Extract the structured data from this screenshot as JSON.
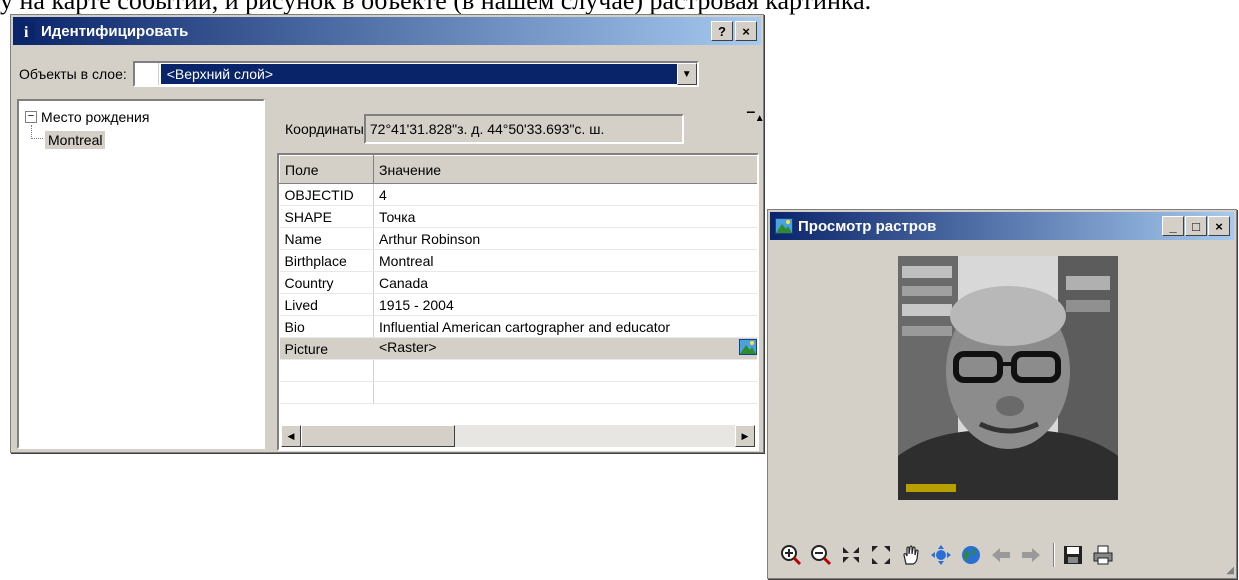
{
  "identify": {
    "title": "Идентифицировать",
    "help_btn": "?",
    "close_btn": "×",
    "layer_label": "Объекты в слое:",
    "layer_value": "<Верхний слой>",
    "tree": {
      "root": "Место рождения",
      "child": "Montreal"
    },
    "coords_label": "Координаты",
    "coords_value": "72°41'31.828\"з. д.  44°50'33.693\"с. ш.",
    "columns": [
      "Поле",
      "Значение"
    ],
    "rows": [
      {
        "field": "OBJECTID",
        "value": "4"
      },
      {
        "field": "SHAPE",
        "value": "Точка"
      },
      {
        "field": "Name",
        "value": "Arthur Robinson"
      },
      {
        "field": "Birthplace",
        "value": "Montreal"
      },
      {
        "field": "Country",
        "value": "Canada"
      },
      {
        "field": "Lived",
        "value": "1915 - 2004"
      },
      {
        "field": "Bio",
        "value": "Influential American cartographer and educator"
      },
      {
        "field": "Picture",
        "value": "<Raster>"
      }
    ]
  },
  "viewer": {
    "title": "Просмотр растров",
    "tools": [
      "zoom-in-icon",
      "zoom-out-icon",
      "fixed-zoom-in-icon",
      "fixed-zoom-out-icon",
      "pan-icon",
      "full-extent-icon",
      "globe-icon",
      "back-icon",
      "forward-icon",
      "save-icon",
      "print-icon"
    ]
  },
  "colors": {
    "title_dark": "#0a246a",
    "title_light": "#a6caf0",
    "face": "#d4d0c8"
  }
}
